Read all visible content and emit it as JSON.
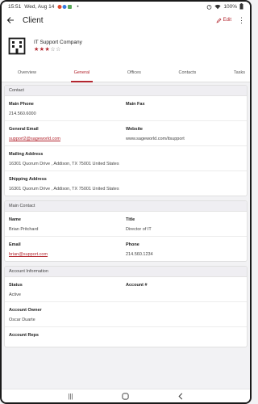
{
  "status_bar": {
    "time": "15:51",
    "date": "Wed, Aug 14",
    "battery": "100%"
  },
  "app_bar": {
    "title": "Client",
    "edit_label": "Edit"
  },
  "company": {
    "name": "IT Support Company",
    "rating_filled": "★★★",
    "rating_empty": "☆☆",
    "rating": 3,
    "rating_max": 5
  },
  "tabs": [
    {
      "label": "Overview"
    },
    {
      "label": "General"
    },
    {
      "label": "Offices"
    },
    {
      "label": "Contacts"
    },
    {
      "label": "Tasks"
    }
  ],
  "contact": {
    "title": "Contact",
    "main_phone_label": "Main Phone",
    "main_phone": "214.560.6000",
    "main_fax_label": "Main Fax",
    "main_fax": "",
    "email_label": "General Email",
    "email": "support2@sageworld.com",
    "website_label": "Website",
    "website": "www.sageworld.com/itsupport",
    "mailing_label": "Mailing Address",
    "mailing": "16301 Quorum Drive , Addison, TX 75001 United States",
    "shipping_label": "Shipping Address",
    "shipping": "16301 Quorum Drive , Addison, TX 75001 United States"
  },
  "main_contact": {
    "title": "Main Contact",
    "name_label": "Name",
    "name": "Brian Pritchard",
    "title_label": "Title",
    "job_title": "Director of IT",
    "email_label": "Email",
    "email": "brian@support.com",
    "phone_label": "Phone",
    "phone": "214.560.1234"
  },
  "account": {
    "title": "Account Information",
    "status_label": "Status",
    "status": "Active",
    "account_no_label": "Account #",
    "account_no": "",
    "owner_label": "Account Owner",
    "owner": "Oscar Duarte",
    "reps_label": "Account Reps",
    "reps": ""
  },
  "colors": {
    "accent": "#b3262f",
    "section_header": "#efeef2"
  }
}
